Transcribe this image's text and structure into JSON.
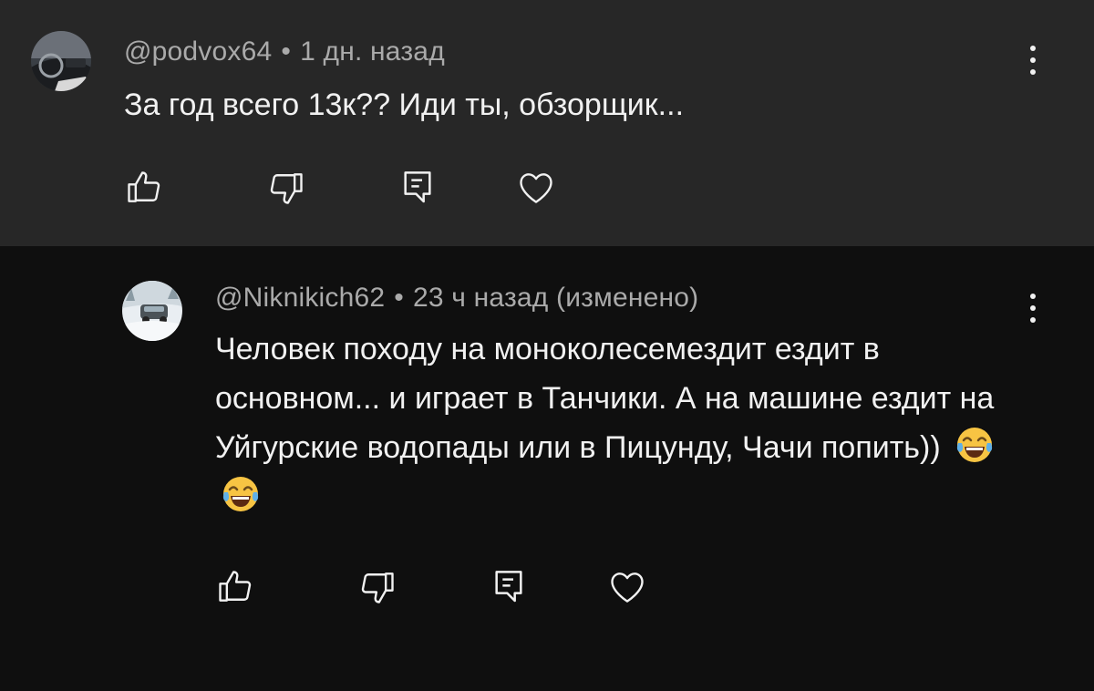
{
  "comments": [
    {
      "author": "@podvox64",
      "separator": "•",
      "time": "1 дн. назад",
      "text": "За год всего 13к?? Иди ты, обзорщик...",
      "icons": {
        "avatar": "car-interior-avatar",
        "like": "thumbs-up-icon",
        "dislike": "thumbs-down-icon",
        "reply": "reply-comment-icon",
        "heart": "heart-icon",
        "menu": "more-vert-icon"
      }
    },
    {
      "author": "@Niknikich62",
      "separator": "•",
      "time": "23 ч назад (изменено)",
      "text": "Человек походу на моноколесемездит ездит в основном... и играет в Танчики. А на машине ездит на Уйгурские водопады или в Пицунду, Чачи попить))",
      "emoji": [
        "face-with-tears-of-joy",
        "face-with-tears-of-joy"
      ],
      "icons": {
        "avatar": "snowy-car-avatar",
        "like": "thumbs-up-icon",
        "dislike": "thumbs-down-icon",
        "reply": "reply-comment-icon",
        "heart": "heart-icon",
        "menu": "more-vert-icon"
      }
    }
  ],
  "colors": {
    "top_background": "#272727",
    "reply_background": "#0f0f0f",
    "text": "#f1f1f1",
    "meta": "#aaaaaa"
  }
}
